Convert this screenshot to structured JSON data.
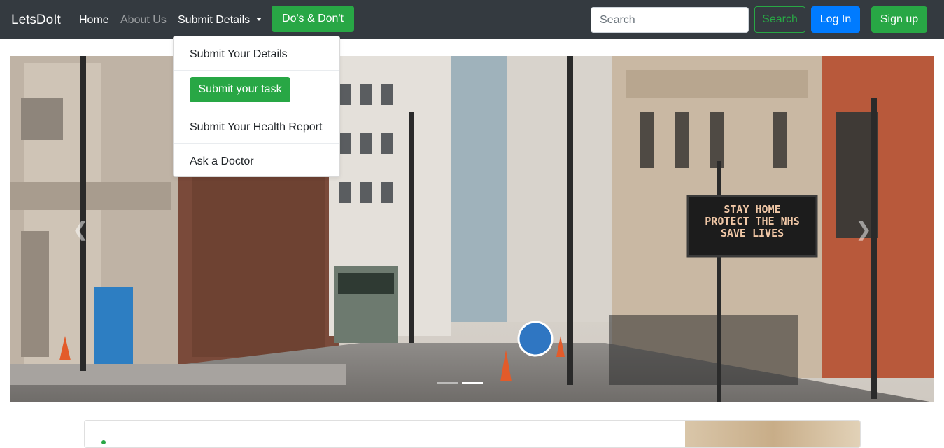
{
  "navbar": {
    "brand": "LetsDoIt",
    "links": {
      "home": "Home",
      "about": "About Us",
      "submit_details": "Submit Details"
    },
    "dos_button": "Do's & Don't",
    "search": {
      "placeholder": "Search",
      "button": "Search"
    },
    "login": "Log In",
    "signup": "Sign up"
  },
  "dropdown": {
    "items": [
      "Submit Your Details",
      "Submit your task",
      "Submit Your Health Report",
      "Ask a Doctor"
    ]
  },
  "carousel": {
    "sign_lines": [
      "STAY HOME",
      "PROTECT THE NHS",
      "SAVE LIVES"
    ],
    "prev_icon": "chevron-left-icon",
    "next_icon": "chevron-right-icon",
    "slide_count": 2,
    "active_slide": 2
  },
  "colors": {
    "navbar_bg": "#343a40",
    "success": "#28a745",
    "primary": "#007bff"
  }
}
